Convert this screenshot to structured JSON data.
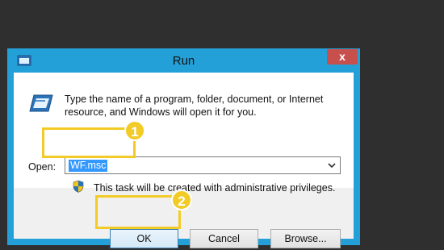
{
  "window": {
    "title": "Run",
    "close_label": "x"
  },
  "dialog": {
    "description": "Type the name of a program, folder, document, or Internet resource, and Windows will open it for you.",
    "open_label": "Open:",
    "open_value": "WF.msc",
    "admin_note": "This task will be created with administrative privileges."
  },
  "buttons": {
    "ok": "OK",
    "cancel": "Cancel",
    "browse": "Browse..."
  },
  "annotations": {
    "step1": "1",
    "step2": "2",
    "highlight_color": "#f2cb26"
  },
  "icons": {
    "title": "run-icon",
    "main": "run-icon",
    "admin": "uac-shield-icon",
    "dropdown": "chevron-down-icon"
  }
}
